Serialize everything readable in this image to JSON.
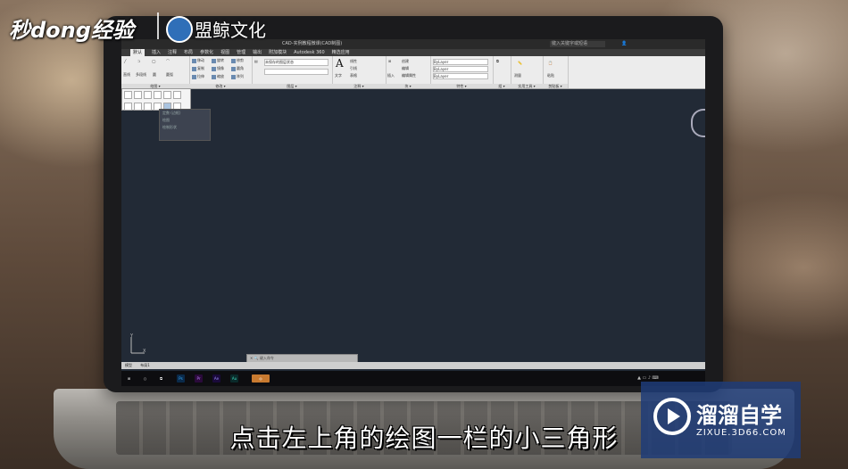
{
  "brand": {
    "left_logo": "秒dong经验",
    "partner_logo": "盟鲸文化"
  },
  "app": {
    "title": "CAD-实例教程微课(CAD制图)",
    "search_placeholder": "键入关键字或短语",
    "menu_tabs": [
      "默认",
      "插入",
      "注释",
      "布局",
      "参数化",
      "视图",
      "管理",
      "输出",
      "附加模块",
      "Autodesk 360",
      "精选应用"
    ],
    "active_tab": "默认"
  },
  "ribbon": {
    "draw": {
      "label": "绘图",
      "line": "直线",
      "polyline": "多段线",
      "circle": "圆",
      "arc": "圆弧"
    },
    "modify": {
      "label": "修改",
      "move": "移动",
      "rotate": "旋转",
      "trim": "修剪",
      "copy": "复制",
      "mirror": "镜像",
      "fillet": "圆角",
      "stretch": "拉伸",
      "scale": "缩放",
      "array": "阵列"
    },
    "layers": {
      "label": "图层",
      "state": "未保存的图层状态"
    },
    "annotation": {
      "label": "注释",
      "text": "文字",
      "dimension": "标注",
      "linear": "线性",
      "leader": "引线",
      "table": "表格"
    },
    "block": {
      "label": "块",
      "insert": "插入",
      "create": "创建",
      "edit": "编辑",
      "edit_attr": "编辑属性"
    },
    "properties": {
      "label": "特性",
      "bylayer1": "ByLayer",
      "bylayer2": "ByLayer",
      "bylayer3": "ByLayer"
    },
    "groups": {
      "label": "组"
    },
    "utilities": {
      "label": "实用工具",
      "measure": "测量"
    },
    "clipboard": {
      "label": "剪贴板",
      "paste": "粘贴"
    }
  },
  "dropdown": {
    "label": "绘图",
    "tooltip_lines": [
      "定数 (边框)",
      "绘图",
      "绘制形状"
    ]
  },
  "command_line": {
    "placeholder": "键入命令"
  },
  "layout_tabs": [
    "模型",
    "布局1"
  ],
  "taskbar": {
    "apps": [
      "Ps",
      "Pr",
      "Ae",
      "Au"
    ]
  },
  "subtitle": "点击左上角的绘图一栏的小三角形",
  "watermark": {
    "title": "溜溜自学",
    "url": "ZIXUE.3D66.COM"
  }
}
